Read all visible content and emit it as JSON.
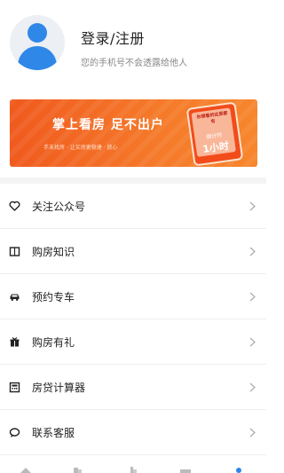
{
  "profile": {
    "avatar_icon": "user-avatar-icon",
    "title": "登录/注册",
    "subtitle": "您的手机号不会透露给他人"
  },
  "banner": {
    "title": "掌上看房 足不出户",
    "subtitle": "手末找房 · 让买房更稳捷 · 放心",
    "phone_text": "你想看的这里都有",
    "phone_countdown": "倒计时",
    "phone_hours": "1小时",
    "colors": {
      "start": "#f05a1e",
      "end": "#f7862d"
    }
  },
  "menu": {
    "items": [
      {
        "label": "关注公众号",
        "icon": "heart-icon"
      },
      {
        "label": "购房知识",
        "icon": "book-icon"
      },
      {
        "label": "预约专车",
        "icon": "car-icon"
      },
      {
        "label": "购房有礼",
        "icon": "gift-icon"
      },
      {
        "label": "房贷计算器",
        "icon": "calculator-icon"
      },
      {
        "label": "联系客服",
        "icon": "chat-bubble-icon"
      }
    ],
    "arrow_icon": "chevron-right-icon"
  },
  "tabbar": {
    "tabs": [
      {
        "icon": "home-icon"
      },
      {
        "icon": "building-icon"
      },
      {
        "icon": "new-house-icon"
      },
      {
        "icon": "news-icon"
      },
      {
        "icon": "profile-icon",
        "active": true
      }
    ],
    "active_color": "#2f87e8"
  }
}
